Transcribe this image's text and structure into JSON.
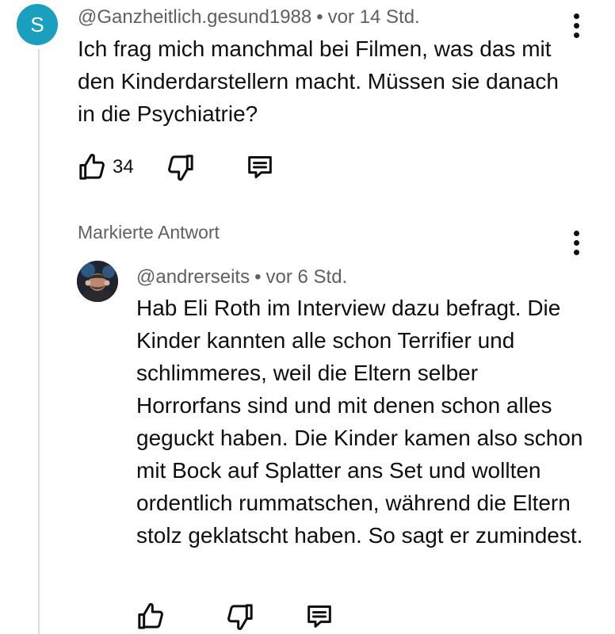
{
  "comment": {
    "avatar_letter": "S",
    "author": "@Ganzheitlich.gesund1988",
    "separator": "•",
    "time": "vor 14 Std.",
    "text": "Ich frag mich manchmal bei Filmen, was das mit den Kinderdarstellern macht. Müssen sie danach in die Psychiatrie?",
    "like_count": "34",
    "avatar_color": "#1a9fbf"
  },
  "reply_section": {
    "label": "Markierte Antwort"
  },
  "reply": {
    "author": "@andrerseits",
    "separator": "•",
    "time": "vor 6 Std.",
    "text": "Hab Eli Roth im Interview dazu befragt. Die Kinder kannten alle schon Terrifier und schlimmeres, weil die Eltern selber Horrorfans sind und mit denen schon alles geguckt haben. Die Kinder kamen also schon mit Bock auf Splatter ans Set und wollten ordentlich rummatschen, während die Eltern stolz geklatscht haben. So sagt er zumindest."
  },
  "icons": {
    "like": "thumbs-up-icon",
    "dislike": "thumbs-down-icon",
    "reply": "reply-comment-icon",
    "more": "more-vertical-icon"
  }
}
